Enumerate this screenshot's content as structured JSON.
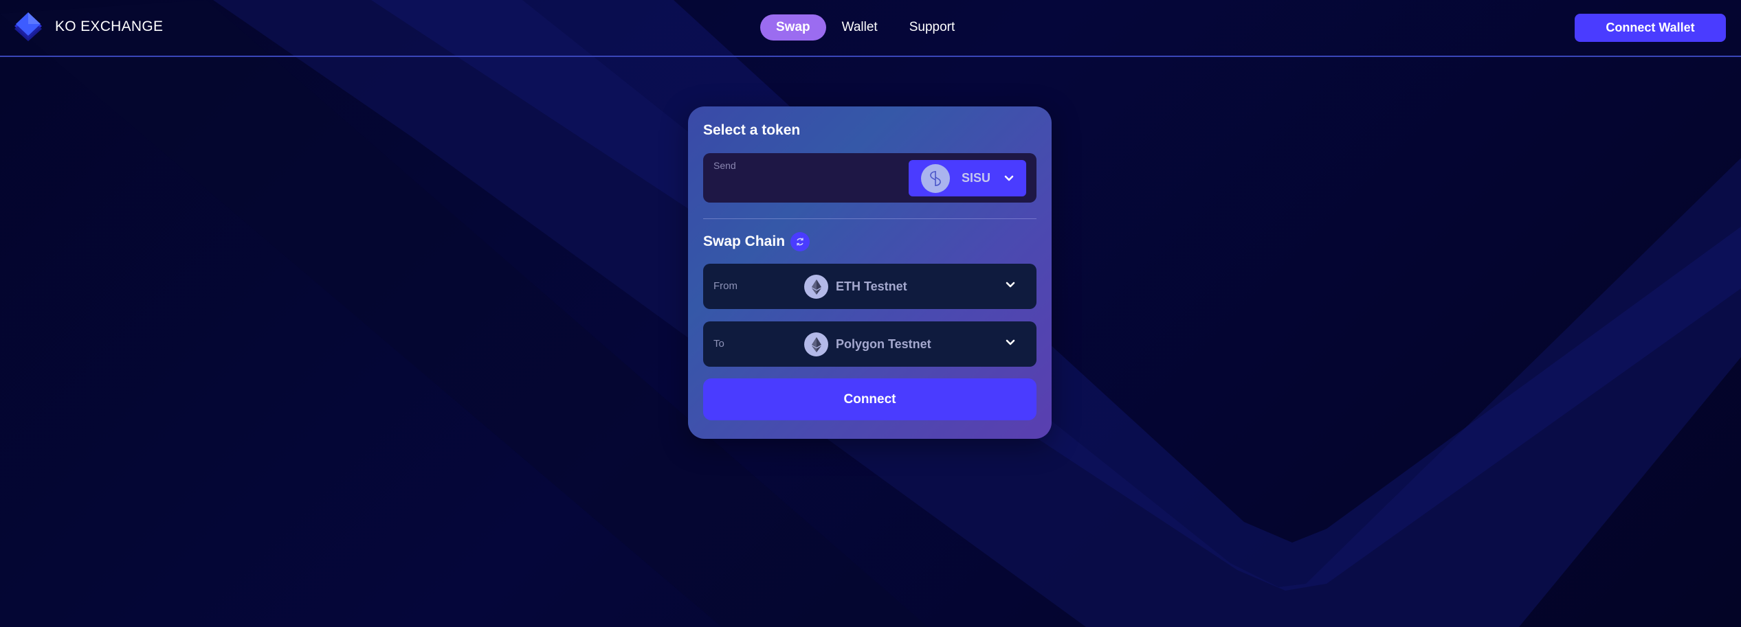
{
  "app": {
    "name": "KO EXCHANGE"
  },
  "nav": {
    "items": [
      {
        "label": "Swap",
        "active": true
      },
      {
        "label": "Wallet",
        "active": false
      },
      {
        "label": "Support",
        "active": false
      }
    ]
  },
  "header": {
    "connect_wallet_label": "Connect Wallet"
  },
  "card": {
    "select_token_title": "Select a token",
    "send_label": "Send",
    "token": {
      "symbol": "SISU",
      "icon": "sisu-token-icon"
    },
    "swap_chain_title": "Swap Chain",
    "from": {
      "label": "From",
      "chain": "ETH Testnet",
      "icon": "ethereum-icon"
    },
    "to": {
      "label": "To",
      "chain": "Polygon Testnet",
      "icon": "ethereum-icon"
    },
    "connect_label": "Connect"
  },
  "colors": {
    "accent": "#4a3cff",
    "nav_active": "#9b6cf0",
    "background": "#03052b"
  }
}
